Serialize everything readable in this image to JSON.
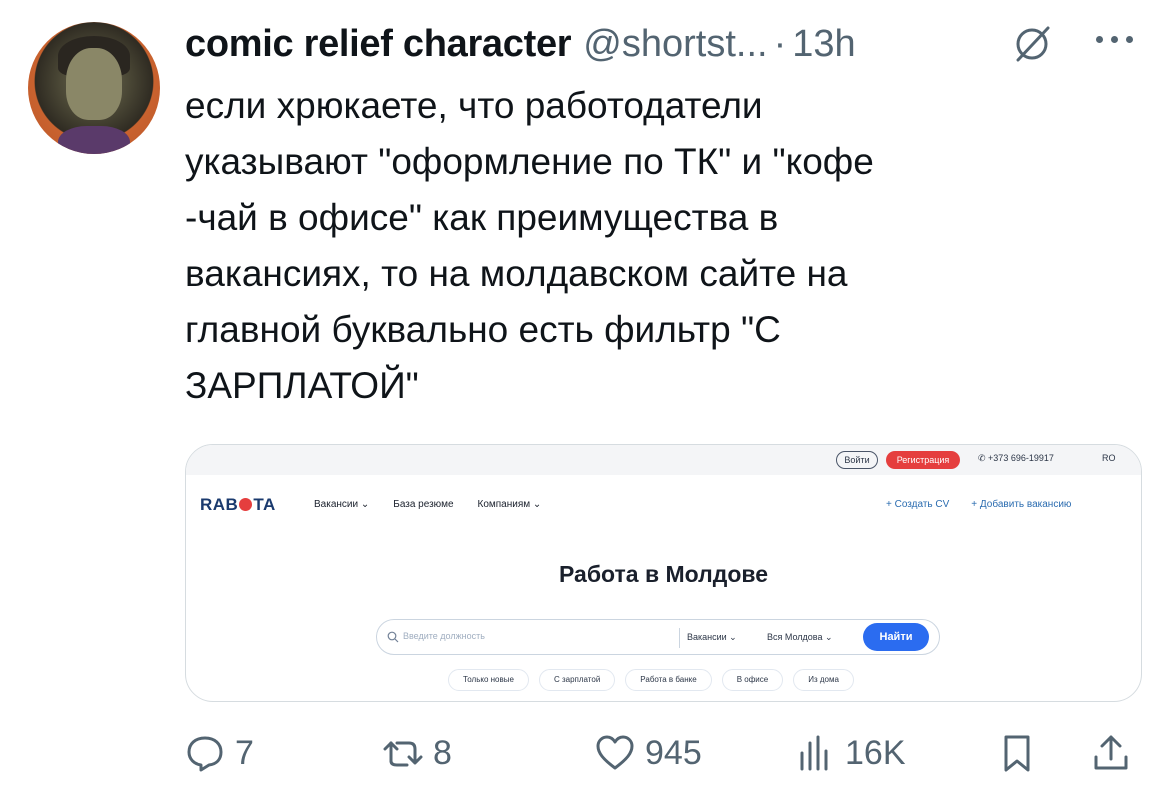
{
  "author": {
    "name": "comic relief character",
    "handle": "@shortst...",
    "separator": "·",
    "time": "13h"
  },
  "tweet_text": "если хрюкаете, что работодатели\nуказывают \"оформление по ТК\" и \"кофе\n-чай в офисе\" как преимущества в\nвакансиях, то на молдавском сайте на\nглавной буквально есть фильтр \"С\nЗАРПЛАТОЙ\"",
  "card": {
    "topbar": {
      "login": "Войти",
      "register": "Регистрация",
      "phone": "+373 696-19917",
      "lang": "RO"
    },
    "logo": "RAB   TA",
    "nav": [
      "Вакансии ⌄",
      "База резюме",
      "Компаниям ⌄"
    ],
    "nav_right": [
      "+ Создать CV",
      "+ Добавить вакансию"
    ],
    "title": "Работа в Молдове",
    "search": {
      "placeholder": "Введите должность",
      "dropdown_type": "Вакансии ⌄",
      "dropdown_region": "Вся Молдова ⌄",
      "button": "Найти"
    },
    "chips": [
      "Только новые",
      "С зарплатой",
      "Работа в банке",
      "В офисе",
      "Из дома"
    ]
  },
  "actions": {
    "replies": "7",
    "reposts": "8",
    "likes": "945",
    "views": "16K"
  },
  "colors": {
    "text": "#0f1419",
    "muted": "#536471",
    "accent_red": "#e53e3e",
    "accent_blue": "#2b6cf0"
  }
}
